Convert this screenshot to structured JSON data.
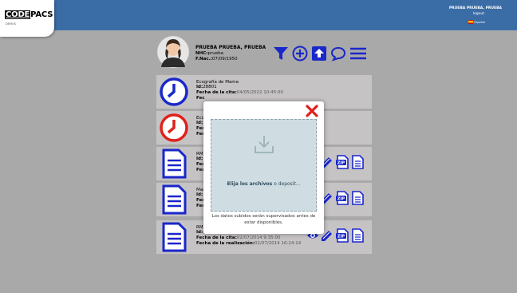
{
  "header": {
    "logo_code": "CODE",
    "logo_pacs": "PACS",
    "logo_sub": "DEMOS",
    "user_name": "PRUEBA PRUEBA, PRUEBA",
    "logout": "logout",
    "language": "Español",
    "color": "#3a6da6"
  },
  "patient": {
    "name": "PRUEBA PRUEBA, PRUEBA",
    "nhc_label": "NHC:",
    "nhc": "prueba",
    "dob_label": "F.Nac.:",
    "dob": "07/09/1950",
    "toolbar_icons": [
      "filter-icon",
      "add-circle-icon",
      "upload-icon",
      "chat-icon",
      "menu-icon"
    ]
  },
  "studies": [
    {
      "icon": "clock-icon",
      "title": "Ecografía de Mama",
      "id_label": "Id:",
      "id": "28801",
      "date_label": "Fecha de la cita:",
      "date": "04/05/2022 10:45:00",
      "extra": "Fec"
    },
    {
      "icon": "clock-red-icon",
      "title": "Eco",
      "id_label": "Id:",
      "id": "3",
      "date_label": "Fec",
      "date": "",
      "extra": "Fec"
    },
    {
      "icon": "document-icon",
      "title": "RM",
      "id_label": "Id:",
      "id": "",
      "date_label": "Fec",
      "date": "",
      "extra": "Fec"
    },
    {
      "icon": "document-icon",
      "title": "Mar",
      "id_label": "Id:",
      "id": "",
      "date_label": "Fec",
      "date": "",
      "extra": "Fec"
    },
    {
      "icon": "document-icon",
      "title": "RM",
      "id_label": "Id:",
      "id": "40002",
      "date_label": "Fecha de la cita:",
      "date": "02/07/2014 9:35:00",
      "real_label": "Fecha de la realización:",
      "real": "02/07/2014 16:24:14"
    }
  ],
  "modal": {
    "drop_bold": "Elija los archivos",
    "drop_rest": " o deposit...",
    "note": "Los datos subidos serán supervisados antes de estar disponibles."
  },
  "colors": {
    "accent": "#1a27c9",
    "danger": "#e0201b",
    "overlay": "#a9a9a9"
  }
}
